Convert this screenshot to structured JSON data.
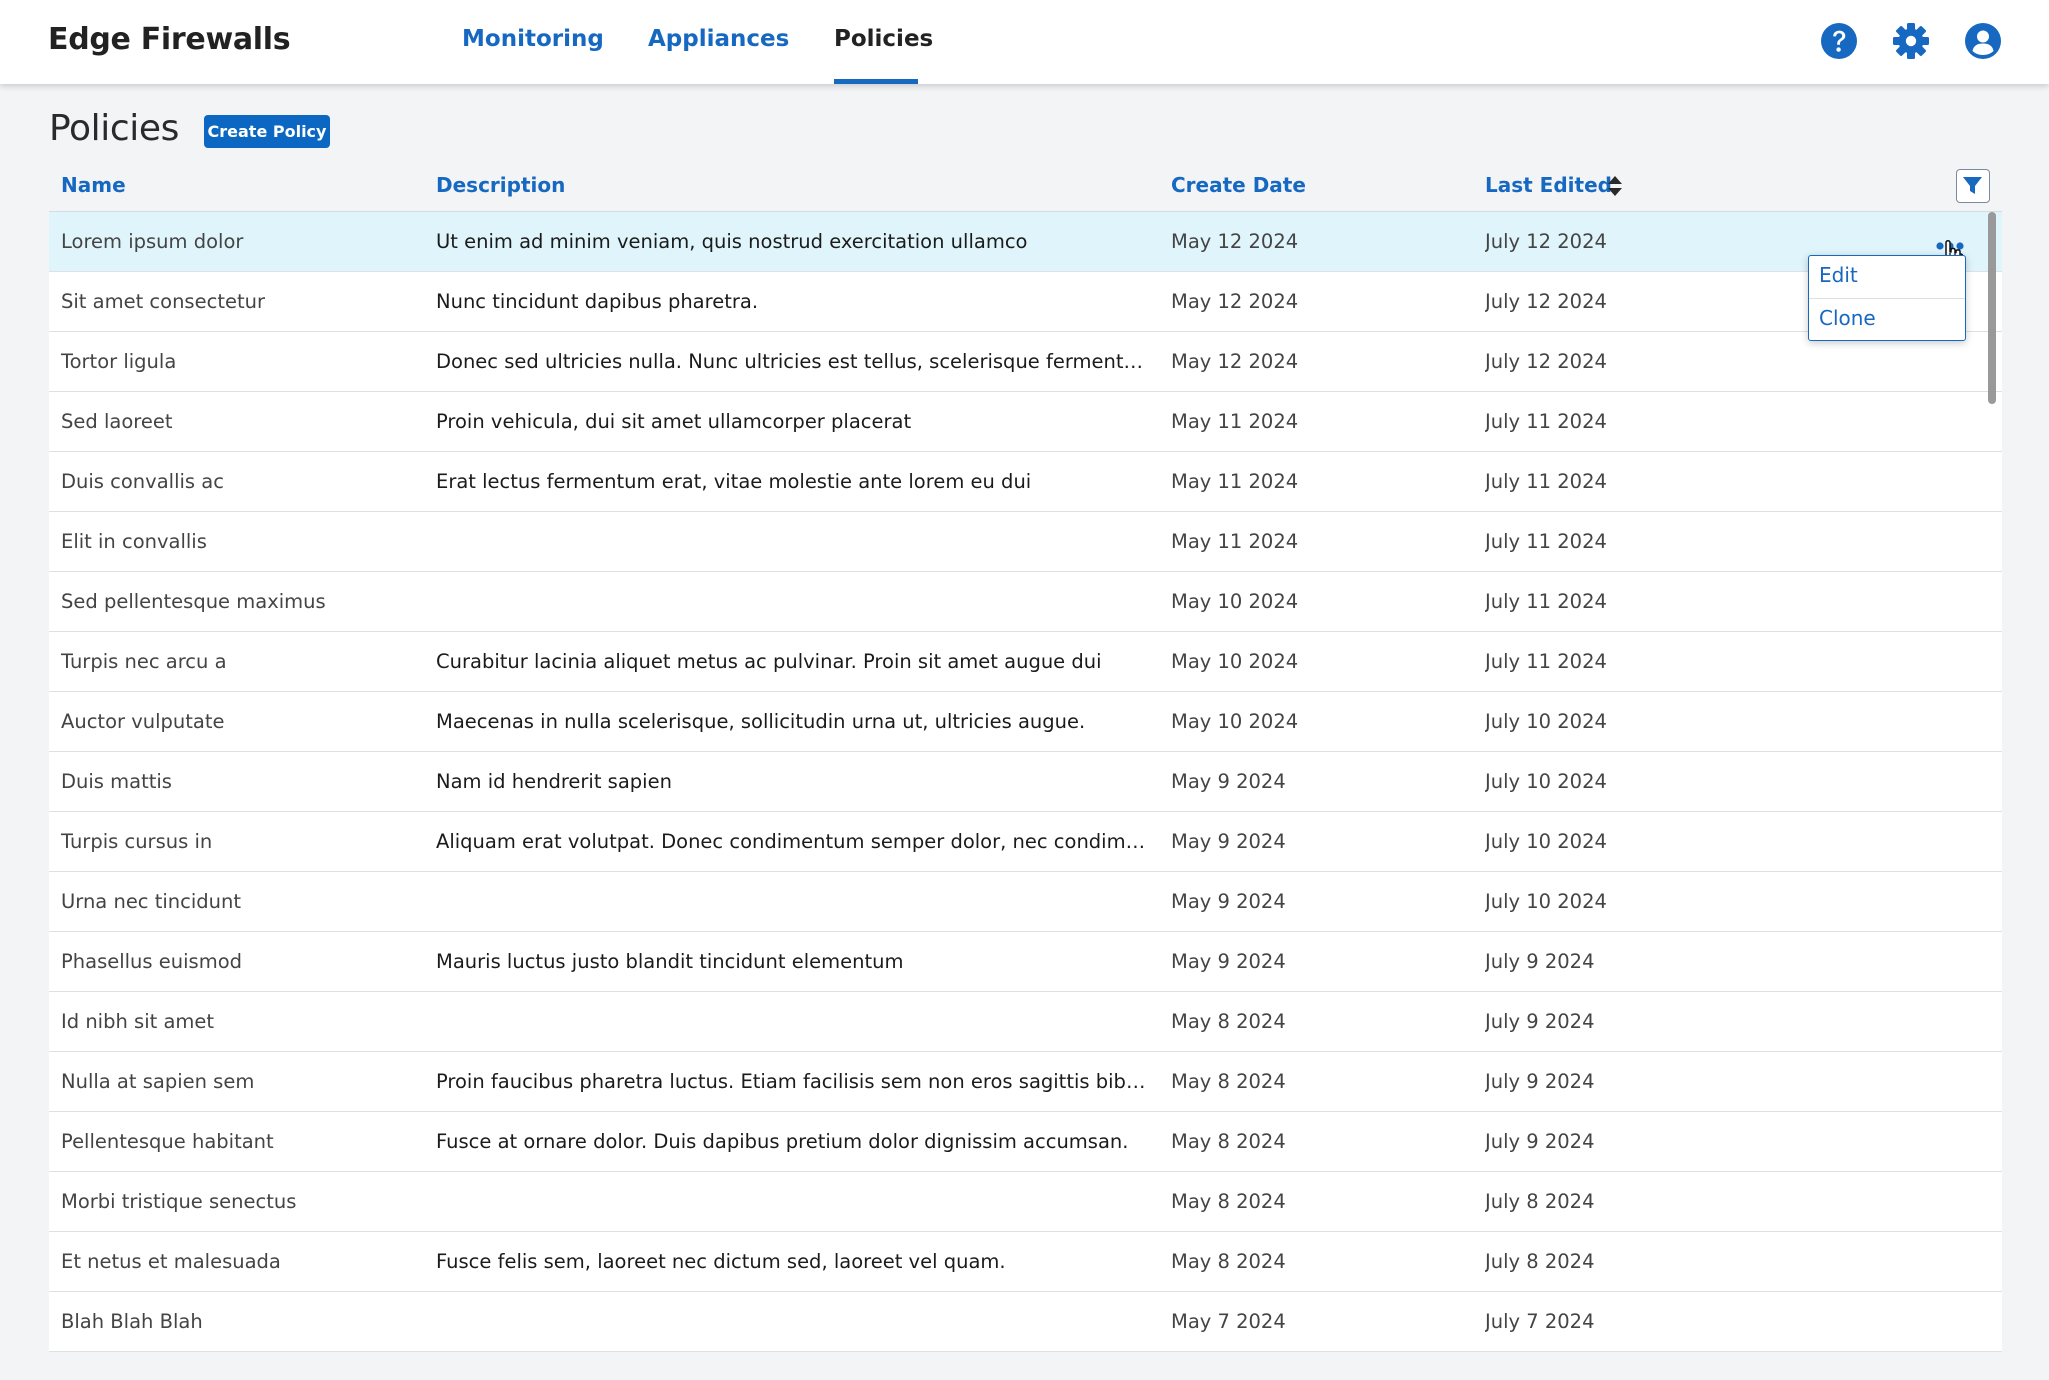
{
  "app": {
    "title": "Edge Firewalls"
  },
  "nav": {
    "tabs": [
      {
        "label": "Monitoring"
      },
      {
        "label": "Appliances"
      },
      {
        "label": "Policies"
      }
    ],
    "active_tab": "Policies"
  },
  "header_icons": [
    "help-icon",
    "gear-icon",
    "user-account-icon"
  ],
  "page": {
    "title": "Policies",
    "create_button": "Create Policy"
  },
  "table": {
    "columns": {
      "name": "Name",
      "description": "Description",
      "create_date": "Create Date",
      "last_edited": "Last Edited"
    },
    "sorted_column": "Last Edited",
    "rows": [
      {
        "name": "Lorem ipsum dolor",
        "description": "Ut enim ad minim veniam, quis nostrud exercitation ullamco",
        "create_date": "May 12 2024",
        "last_edited": "July 12 2024"
      },
      {
        "name": "Sit amet consectetur",
        "description": "Nunc tincidunt dapibus pharetra.",
        "create_date": "May 12 2024",
        "last_edited": "July 12 2024"
      },
      {
        "name": "Tortor ligula",
        "description": "Donec sed ultricies nulla. Nunc ultricies est tellus, scelerisque fermentum elit...",
        "create_date": "May 12 2024",
        "last_edited": "July 12 2024"
      },
      {
        "name": "Sed laoreet",
        "description": "Proin vehicula, dui sit amet ullamcorper placerat",
        "create_date": "May 11 2024",
        "last_edited": "July 11 2024"
      },
      {
        "name": "Duis convallis ac",
        "description": "Erat lectus fermentum erat, vitae molestie ante lorem eu dui",
        "create_date": "May 11 2024",
        "last_edited": "July 11 2024"
      },
      {
        "name": "Elit in  convallis",
        "description": "",
        "create_date": "May 11 2024",
        "last_edited": "July 11 2024"
      },
      {
        "name": "Sed pellentesque maximus",
        "description": "",
        "create_date": "May 10 2024",
        "last_edited": "July 11 2024"
      },
      {
        "name": "Turpis nec arcu a",
        "description": "Curabitur lacinia aliquet metus ac pulvinar. Proin sit amet augue dui",
        "create_date": "May 10 2024",
        "last_edited": "July 11 2024"
      },
      {
        "name": "Auctor vulputate",
        "description": "Maecenas in nulla scelerisque, sollicitudin urna ut, ultricies augue.",
        "create_date": "May 10 2024",
        "last_edited": "July 10 2024"
      },
      {
        "name": "Duis mattis",
        "description": "Nam id hendrerit sapien",
        "create_date": "May 9 2024",
        "last_edited": "July 10 2024"
      },
      {
        "name": "Turpis cursus in",
        "description": "Aliquam erat volutpat. Donec condimentum semper dolor, nec condimentum...",
        "create_date": "May 9 2024",
        "last_edited": "July 10 2024"
      },
      {
        "name": "Urna nec tincidunt",
        "description": "",
        "create_date": "May 9 2024",
        "last_edited": "July 10 2024"
      },
      {
        "name": "Phasellus euismod",
        "description": "Mauris luctus justo blandit tincidunt elementum",
        "create_date": "May 9 2024",
        "last_edited": "July 9 2024"
      },
      {
        "name": "Id nibh sit amet",
        "description": "",
        "create_date": "May 8 2024",
        "last_edited": "July 9 2024"
      },
      {
        "name": "Nulla at sapien sem",
        "description": "Proin faucibus pharetra luctus. Etiam facilisis sem non eros sagittis bibendum.",
        "create_date": "May 8 2024",
        "last_edited": "July 9 2024"
      },
      {
        "name": "Pellentesque habitant",
        "description": "Fusce at ornare dolor. Duis dapibus pretium dolor dignissim accumsan.",
        "create_date": "May 8 2024",
        "last_edited": "July 9 2024"
      },
      {
        "name": "Morbi tristique senectus",
        "description": "",
        "create_date": "May 8 2024",
        "last_edited": "July 8 2024"
      },
      {
        "name": "Et netus et malesuada",
        "description": "Fusce felis sem, laoreet nec dictum sed, laoreet vel quam.",
        "create_date": "May 8 2024",
        "last_edited": "July 8 2024"
      },
      {
        "name": "Blah Blah Blah",
        "description": "",
        "create_date": "May 7 2024",
        "last_edited": "July 7 2024"
      }
    ]
  },
  "context_menu": {
    "items": [
      {
        "label": "Edit"
      },
      {
        "label": "Clone"
      }
    ]
  },
  "colors": {
    "accent": "#1668c1",
    "selected_row": "#dff4fb",
    "page_bg": "#f3f4f6"
  }
}
